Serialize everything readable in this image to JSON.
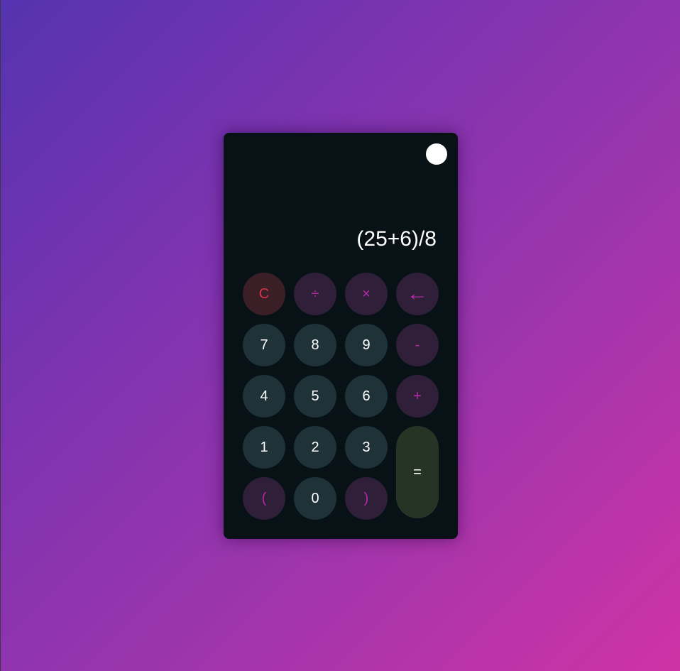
{
  "display": {
    "expression": "(25+6)/8"
  },
  "keys": {
    "clear": "C",
    "divide": "÷",
    "multiply": "×",
    "backspace": "←",
    "seven": "7",
    "eight": "8",
    "nine": "9",
    "minus": "-",
    "four": "4",
    "five": "5",
    "six": "6",
    "plus": "+",
    "one": "1",
    "two": "2",
    "three": "3",
    "equals": "=",
    "open_paren": "(",
    "zero": "0",
    "close_paren": ")"
  },
  "colors": {
    "background_gradient_start": "#5533b0",
    "background_gradient_end": "#cf33a5",
    "calculator_bg": "#081115",
    "number_key_bg": "#1e3238",
    "operator_key_bg": "#2f1f38",
    "operator_text": "#b82aa8",
    "clear_key_bg": "#3a1f27",
    "clear_text": "#d5344a",
    "equals_key_bg": "#263426",
    "theme_toggle": "#ffffff"
  },
  "icons": {
    "theme_toggle": "circle-toggle-icon",
    "backspace": "left-arrow-icon"
  }
}
